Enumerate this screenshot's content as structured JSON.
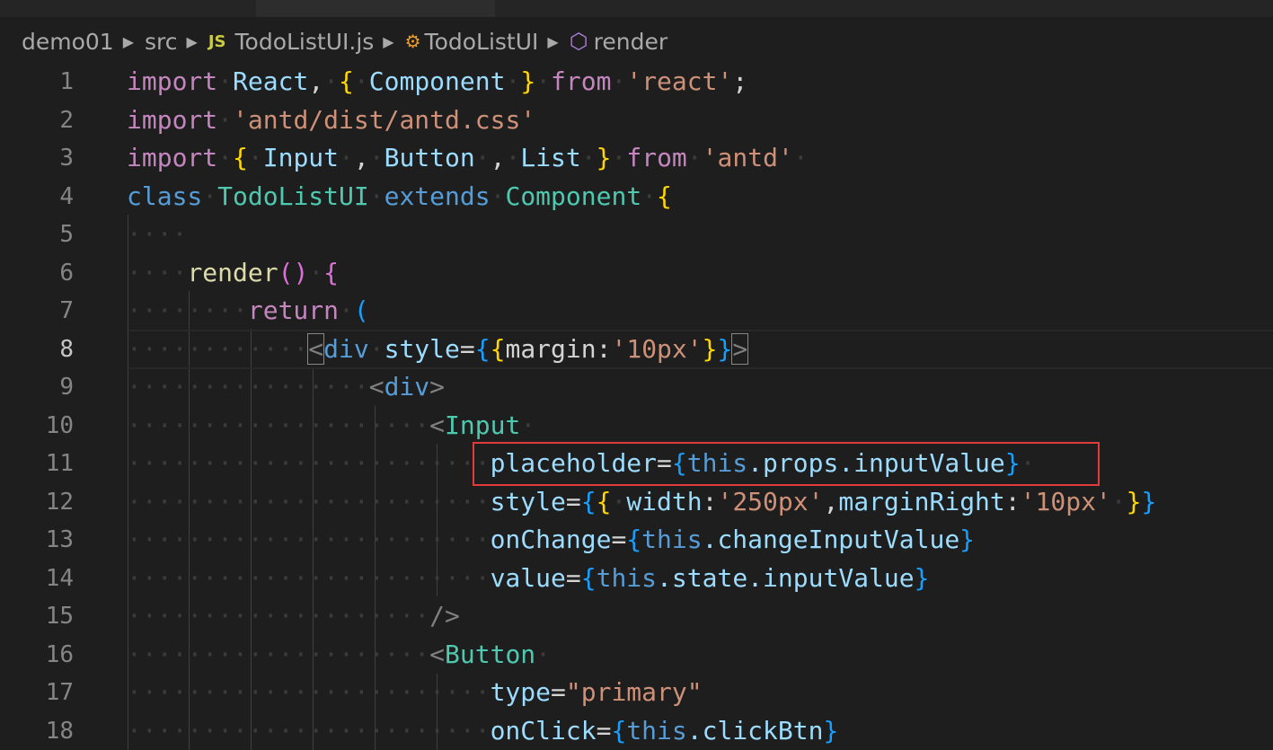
{
  "breadcrumb": {
    "folder": "demo01",
    "subfolder": "src",
    "file_icon": "JS",
    "file": "TodoListUI.js",
    "class_icon": "class-icon",
    "class_name": "TodoListUI",
    "method_icon": "method-cube-icon",
    "method_name": "render"
  },
  "active_line": 8,
  "highlighted_line": 11,
  "lines": [
    {
      "n": "1"
    },
    {
      "n": "2"
    },
    {
      "n": "3"
    },
    {
      "n": "4"
    },
    {
      "n": "5"
    },
    {
      "n": "6"
    },
    {
      "n": "7"
    },
    {
      "n": "8"
    },
    {
      "n": "9"
    },
    {
      "n": "10"
    },
    {
      "n": "11"
    },
    {
      "n": "12"
    },
    {
      "n": "13"
    },
    {
      "n": "14"
    },
    {
      "n": "15"
    },
    {
      "n": "16"
    },
    {
      "n": "17"
    },
    {
      "n": "18"
    }
  ],
  "code": {
    "l1": {
      "import": "import",
      "react": "React",
      "component": "Component",
      "from": "from",
      "module": "'react'"
    },
    "l2": {
      "import": "import",
      "module": "'antd/dist/antd.css'"
    },
    "l3": {
      "import": "import",
      "input": "Input",
      "button": "Button",
      "list": "List",
      "from": "from",
      "module": "'antd'"
    },
    "l4": {
      "class": "class",
      "name": "TodoListUI",
      "extends": "extends",
      "base": "Component"
    },
    "l6": {
      "render": "render"
    },
    "l7": {
      "return": "return"
    },
    "l8": {
      "tag": "div",
      "attr": "style",
      "key": "margin",
      "value": "'10px'"
    },
    "l9": {
      "tag": "div"
    },
    "l10": {
      "tag": "Input"
    },
    "l11": {
      "attr": "placeholder",
      "this": "this",
      "path": ".props.inputValue"
    },
    "l12": {
      "attr": "style",
      "k1": "width",
      "v1": "'250px'",
      "k2": "marginRight",
      "v2": "'10px'"
    },
    "l13": {
      "attr": "onChange",
      "this": "this",
      "path": ".changeInputValue"
    },
    "l14": {
      "attr": "value",
      "this": "this",
      "path": ".state.inputValue"
    },
    "l16": {
      "tag": "Button"
    },
    "l17": {
      "attr": "type",
      "value": "\"primary\""
    },
    "l18": {
      "attr": "onClick",
      "this": "this",
      "path": ".clickBtn"
    }
  },
  "colors": {
    "background": "#1e1e1e",
    "keyword": "#c586c0",
    "storage": "#569cd6",
    "variable": "#9cdcfe",
    "type": "#4ec9b0",
    "string": "#ce9178",
    "function": "#dcdcaa",
    "highlight_box": "#e03c3c"
  }
}
